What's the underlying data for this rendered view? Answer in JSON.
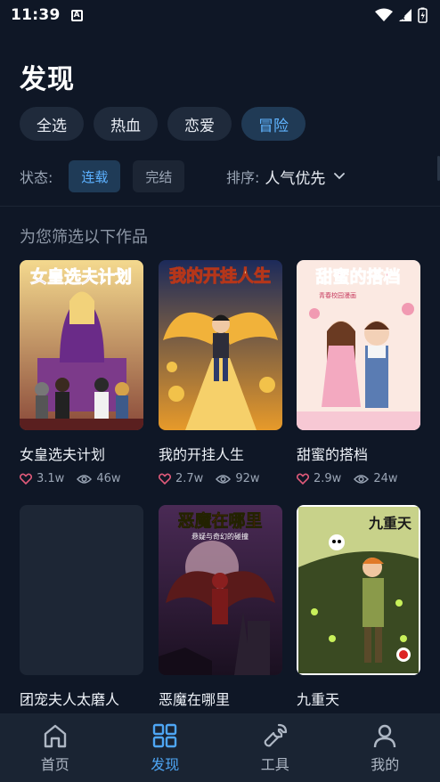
{
  "status_bar": {
    "time": "11:39",
    "notification_badge": "A"
  },
  "header": {
    "title": "发现"
  },
  "genre_chips": [
    {
      "label": "全选",
      "active": false
    },
    {
      "label": "热血",
      "active": false
    },
    {
      "label": "恋爱",
      "active": false
    },
    {
      "label": "冒险",
      "active": true
    }
  ],
  "filters": {
    "status_label": "状态:",
    "status_options": [
      {
        "label": "连载",
        "active": true
      },
      {
        "label": "完结",
        "active": false
      }
    ],
    "sort_label": "排序:",
    "sort_value": "人气优先"
  },
  "section_title": "为您筛选以下作品",
  "comics": [
    {
      "title": "女皇选夫计划",
      "likes": "3.1w",
      "views": "46w",
      "cover_text": "女皇选夫计划"
    },
    {
      "title": "我的开挂人生",
      "likes": "2.7w",
      "views": "92w",
      "cover_text": "我的开挂人生"
    },
    {
      "title": "甜蜜的搭档",
      "likes": "2.9w",
      "views": "24w",
      "cover_text": "甜蜜的搭档",
      "cover_subtext": "青春校园漫画"
    },
    {
      "title": "团宠夫人太磨人",
      "likes": "",
      "views": ""
    },
    {
      "title": "恶魔在哪里",
      "likes": "",
      "views": "",
      "cover_text": "恶魔在哪里",
      "cover_subtext": "悬疑与奇幻的碰撞"
    },
    {
      "title": "九重天",
      "likes": "",
      "views": "",
      "cover_text": "九重天"
    }
  ],
  "bottom_nav": [
    {
      "label": "首页",
      "icon": "home-icon",
      "active": false
    },
    {
      "label": "发现",
      "icon": "grid-icon",
      "active": true
    },
    {
      "label": "工具",
      "icon": "wrench-icon",
      "active": false
    },
    {
      "label": "我的",
      "icon": "user-icon",
      "active": false
    }
  ],
  "colors": {
    "background": "#0f1726",
    "accent": "#4ea6f5",
    "like_heart": "#e05a7a"
  }
}
